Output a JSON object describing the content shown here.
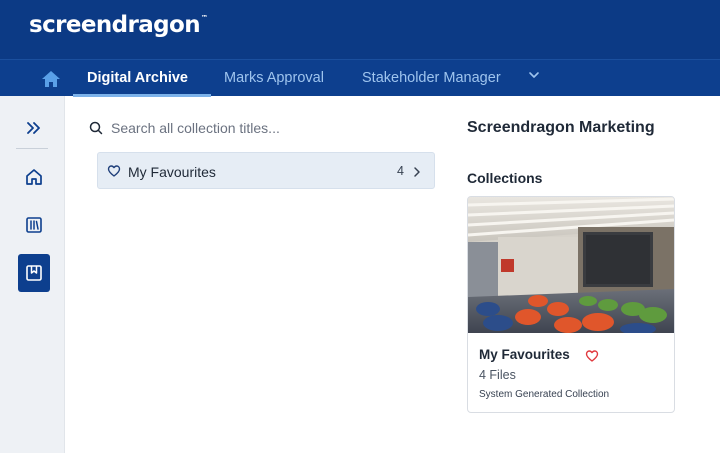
{
  "header": {
    "logo_text": "screendragon",
    "logo_tm": "™"
  },
  "nav": {
    "tabs": [
      {
        "label": "Digital Archive",
        "active": true
      },
      {
        "label": "Marks Approval",
        "active": false
      },
      {
        "label": "Stakeholder Manager",
        "active": false,
        "has_dropdown": true
      }
    ]
  },
  "sidebar": {
    "items": [
      {
        "icon": "double-chevron-right-icon"
      },
      {
        "icon": "home-icon"
      },
      {
        "icon": "library-icon"
      },
      {
        "icon": "bookmark-archive-icon",
        "active": true
      }
    ]
  },
  "search": {
    "placeholder": "Search all collection titles..."
  },
  "favourites_row": {
    "label": "My Favourites",
    "count": "4"
  },
  "right_panel": {
    "title": "Screendragon Marketing",
    "section_title": "Collections",
    "card": {
      "title": "My Favourites",
      "files": "4 Files",
      "description": "System Generated Collection"
    }
  },
  "colors": {
    "header_bg": "#0c3a85",
    "nav_bg": "#0d3f8e",
    "active_underline": "#7cb2ea",
    "sidebar_bg": "#eef1f5",
    "fav_row_bg": "#e6edf5",
    "heart_red": "#e0393e"
  }
}
